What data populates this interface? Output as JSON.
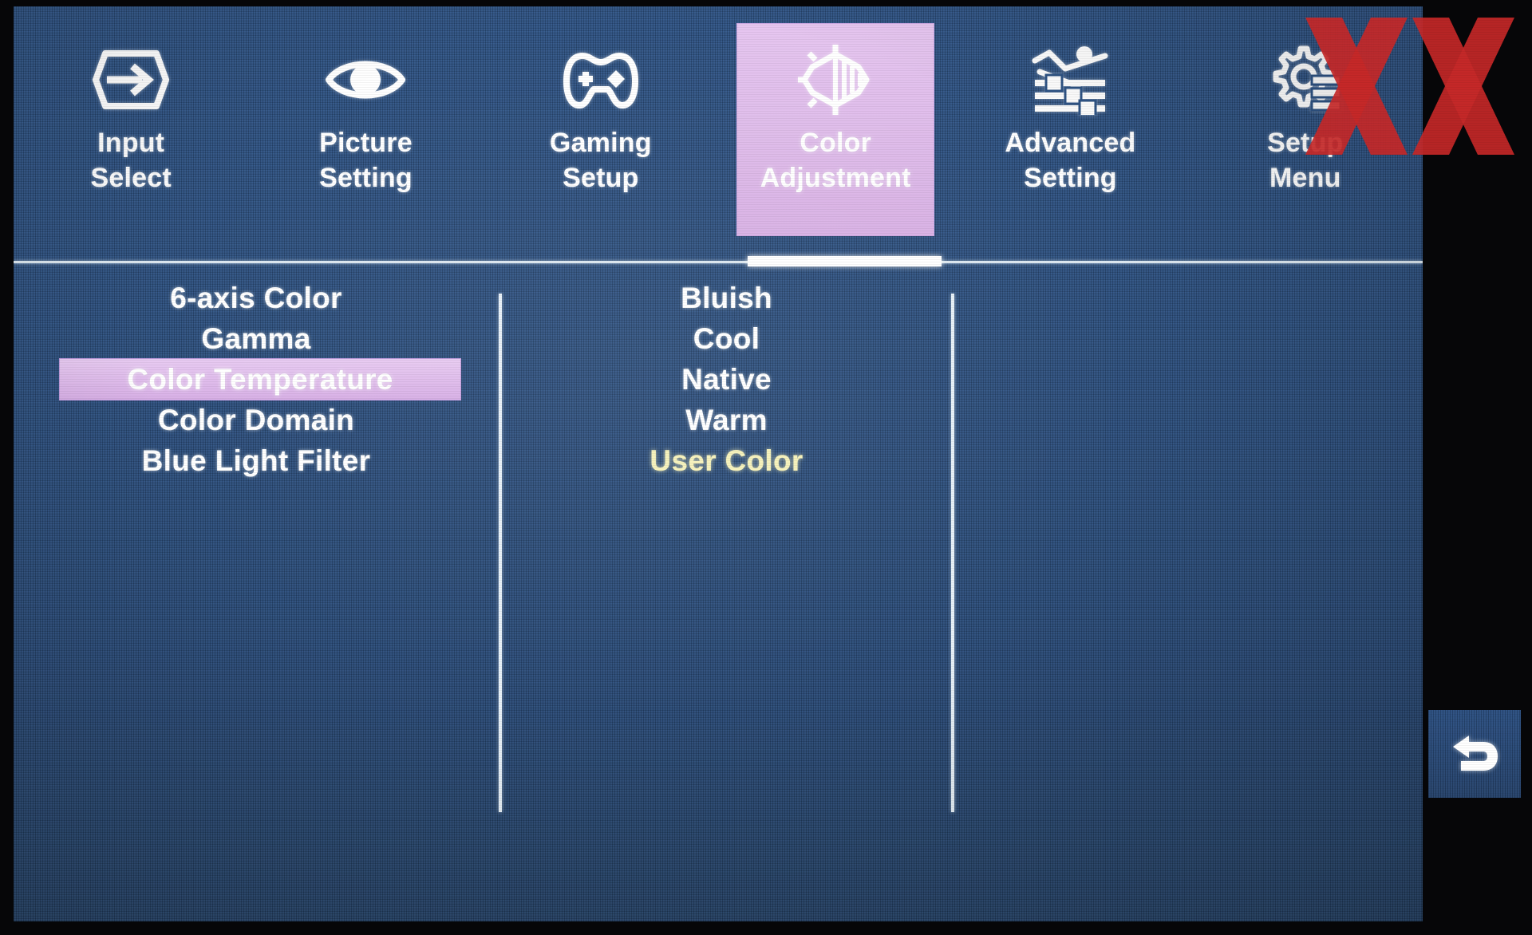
{
  "osd": {
    "colors": {
      "panel_blue": "#2f5485",
      "highlight_lavender": "#dfbcea",
      "selected_value_yellow": "#f6f2bb",
      "text_white": "#ffffff",
      "watermark_red": "#c62828"
    },
    "tabs": [
      {
        "icon": "input-arrow-icon",
        "line1": "Input",
        "line2": "Select",
        "active": false
      },
      {
        "icon": "eye-icon",
        "line1": "Picture",
        "line2": "Setting",
        "active": false
      },
      {
        "icon": "gamepad-icon",
        "line1": "Gaming",
        "line2": "Setup",
        "active": false
      },
      {
        "icon": "brightness-contrast-icon",
        "line1": "Color",
        "line2": "Adjustment",
        "active": true
      },
      {
        "icon": "graph-sliders-icon",
        "line1": "Advanced",
        "line2": "Setting",
        "active": false
      },
      {
        "icon": "gear-list-icon",
        "line1": "Setup",
        "line2": "Menu",
        "active": false
      }
    ],
    "left_menu": [
      {
        "label": "6-axis Color",
        "selected": false
      },
      {
        "label": "Gamma",
        "selected": false
      },
      {
        "label": "Color Temperature",
        "selected": true
      },
      {
        "label": "Color Domain",
        "selected": false
      },
      {
        "label": "Blue Light Filter",
        "selected": false
      }
    ],
    "middle_menu": [
      {
        "label": "Bluish",
        "value_selected": false
      },
      {
        "label": "Cool",
        "value_selected": false
      },
      {
        "label": "Native",
        "value_selected": false
      },
      {
        "label": "Warm",
        "value_selected": false
      },
      {
        "label": "User Color",
        "value_selected": true
      }
    ],
    "right_panel": [],
    "back_button": {
      "icon": "return-arrow-icon",
      "label": ""
    },
    "watermark": {
      "text": "XX"
    }
  }
}
